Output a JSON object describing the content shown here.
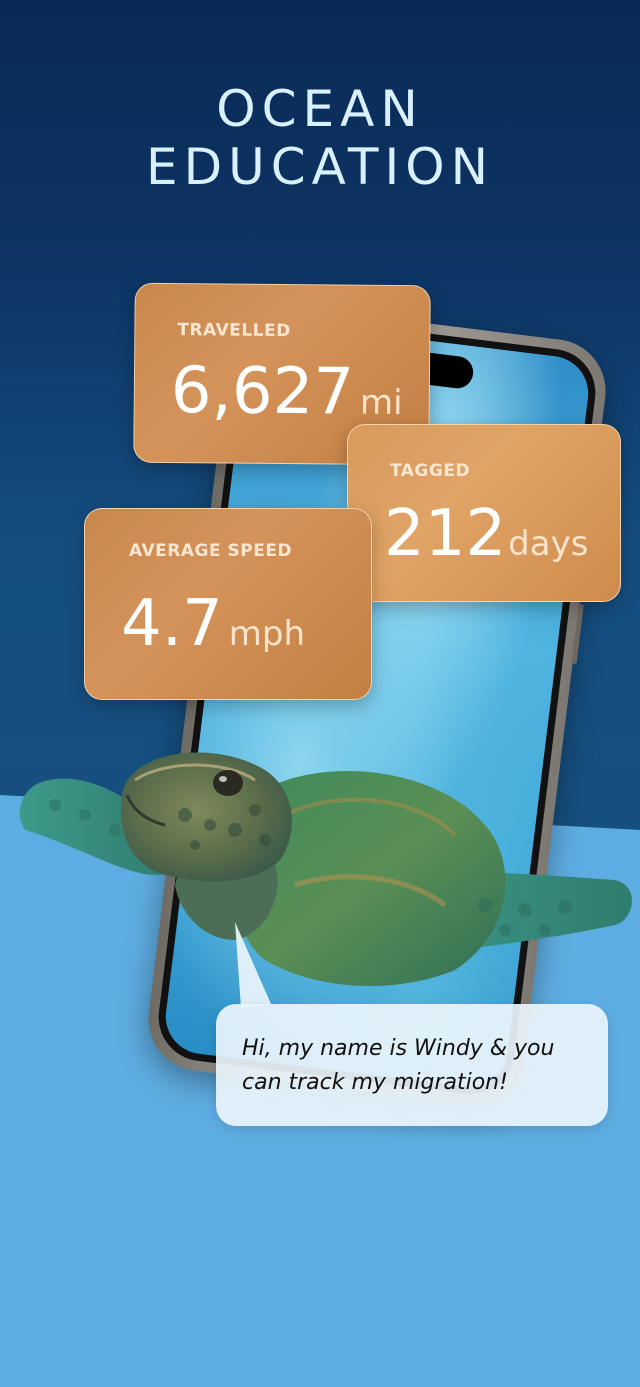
{
  "header": {
    "title_line1": "OCEAN",
    "title_line2": "EDUCATION"
  },
  "stats": {
    "travelled": {
      "label": "TRAVELLED",
      "value": "6,627",
      "unit": "mi"
    },
    "tagged": {
      "label": "TAGGED",
      "value": "212",
      "unit": "days"
    },
    "average_speed": {
      "label": "AVERAGE SPEED",
      "value": "4.7",
      "unit": "mph"
    }
  },
  "bubble": {
    "text": "Hi, my name is Windy & you can track my migration!"
  },
  "colors": {
    "card": "#c9874c",
    "ocean_dark": "#0a2a55",
    "ocean_light": "#5eade2",
    "title": "#d9f1ff"
  },
  "icons": [
    "sea-turtle-illustration",
    "phone-mockup"
  ]
}
